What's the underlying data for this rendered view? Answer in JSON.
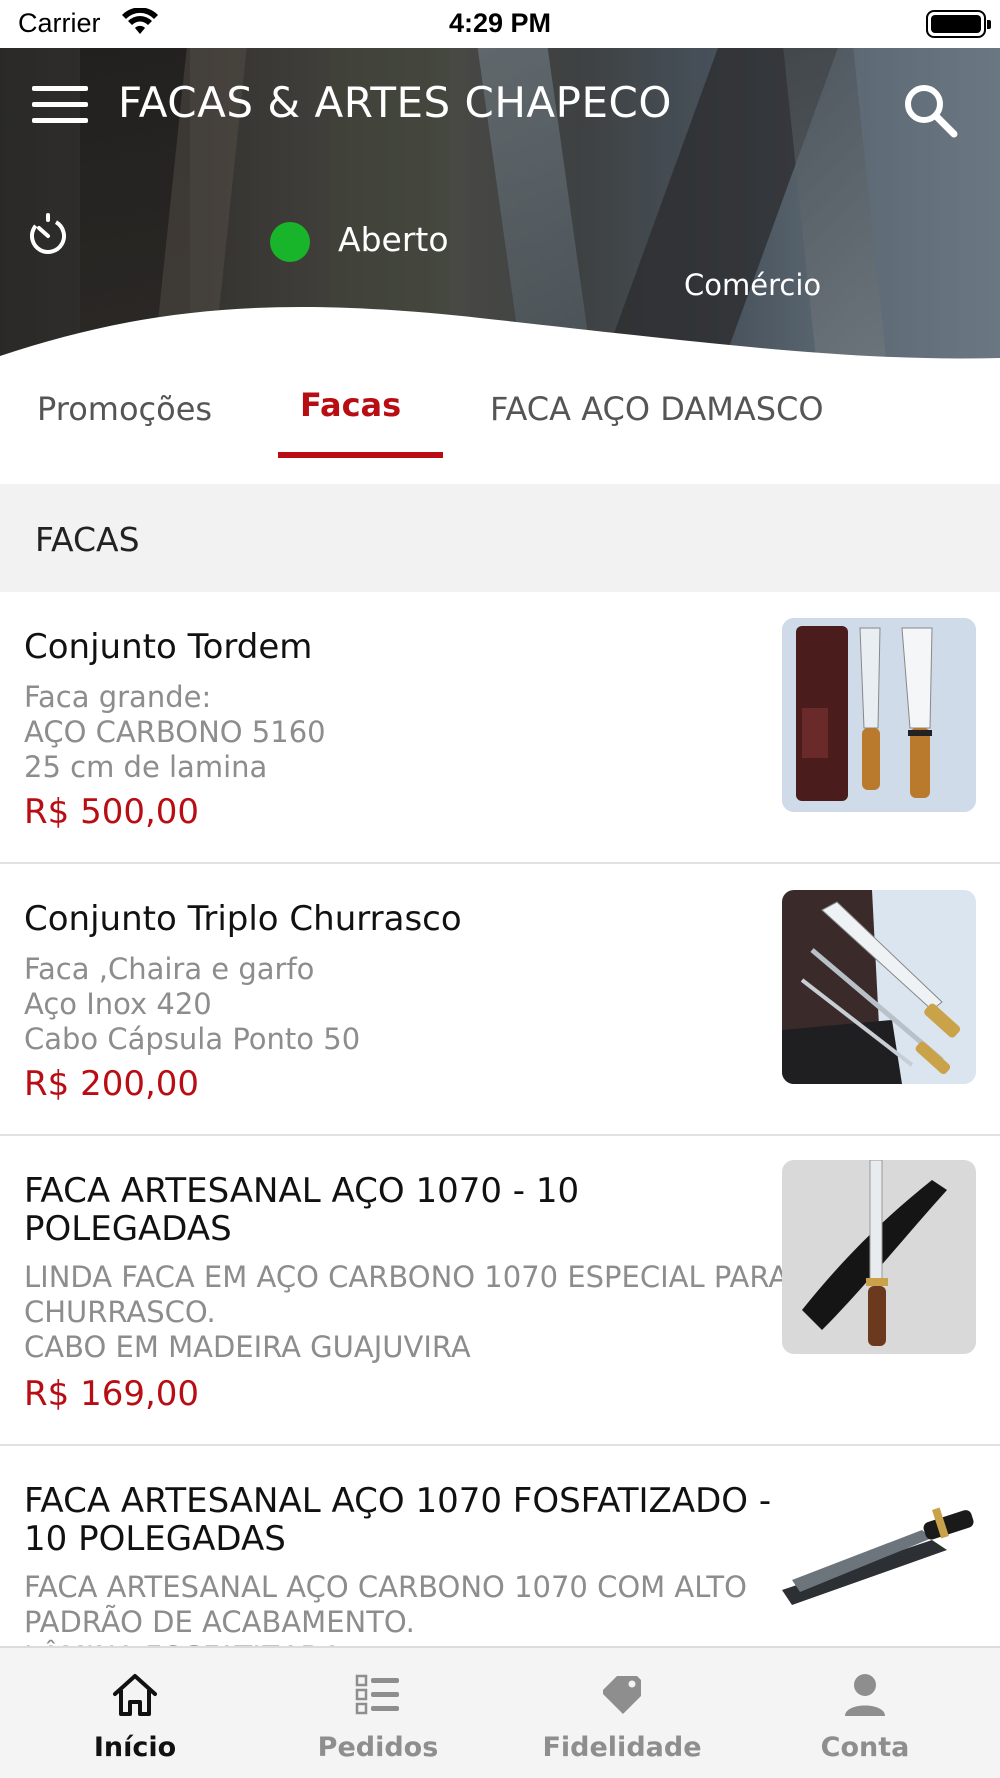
{
  "status_bar": {
    "carrier": "Carrier",
    "time": "4:29 PM"
  },
  "header": {
    "title": "FACAS & ARTES CHAPECO",
    "status": "Aberto",
    "status_color": "#18b52a",
    "category": "Comércio"
  },
  "tabs": [
    {
      "label": "Promoções",
      "active": false
    },
    {
      "label": "Facas",
      "active": true
    },
    {
      "label": "FACA AÇO DAMASCO",
      "active": false
    }
  ],
  "accent_color": "#b80e13",
  "section": {
    "title": "FACAS"
  },
  "products": [
    {
      "name": "Conjunto Tordem",
      "description": "Faca grande:\nAÇO CARBONO 5160\n25 cm de lamina",
      "price": "R$ 500,00"
    },
    {
      "name": "Conjunto Triplo Churrasco",
      "description": "Faca ,Chaira e garfo\nAço Inox 420\nCabo Cápsula Ponto 50",
      "price": "R$ 200,00"
    },
    {
      "name": "FACA ARTESANAL AÇO 1070 - 10 POLEGADAS",
      "description": "LINDA FACA EM AÇO CARBONO 1070 ESPECIAL PARA CHURRASCO.\nCABO EM MADEIRA GUAJUVIRA",
      "price": "R$ 169,00"
    },
    {
      "name": "FACA ARTESANAL AÇO 1070 FOSFATIZADO - 10 POLEGADAS",
      "description": "FACA ARTESANAL AÇO CARBONO 1070 COM ALTO PADRÃO DE ACABAMENTO.\nLÂMINA FOSFATIZADA",
      "price": ""
    }
  ],
  "tabbar": [
    {
      "label": "Início",
      "icon": "home-icon",
      "active": true
    },
    {
      "label": "Pedidos",
      "icon": "orders-list-icon",
      "active": false
    },
    {
      "label": "Fidelidade",
      "icon": "loyalty-tag-icon",
      "active": false
    },
    {
      "label": "Conta",
      "icon": "account-icon",
      "active": false
    }
  ]
}
